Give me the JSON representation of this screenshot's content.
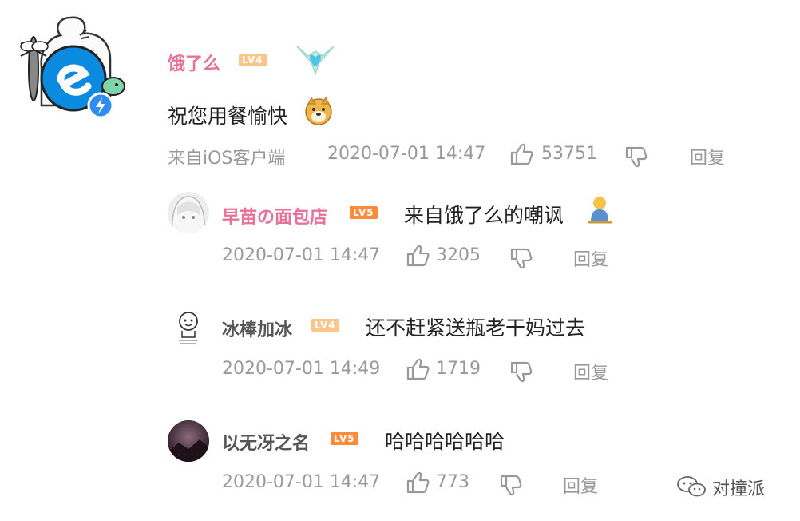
{
  "main_comment": {
    "username": "饿了么",
    "level": "LV4",
    "text": "祝您用餐愉快",
    "source": "来自iOS客户端",
    "time": "2020-07-01 14:47",
    "likes": "53751",
    "reply_label": "回复"
  },
  "replies": [
    {
      "username": "早苗の面包店",
      "level": "LV5",
      "text": "来自饿了么的嘲讽",
      "time": "2020-07-01 14:47",
      "likes": "3205",
      "reply_label": "回复"
    },
    {
      "username": "冰棒加冰",
      "level": "LV4",
      "text": "还不赶紧送瓶老干妈过去",
      "time": "2020-07-01 14:49",
      "likes": "1719",
      "reply_label": "回复"
    },
    {
      "username": "以无冴之名",
      "level": "LV5",
      "text": "哈哈哈哈哈哈",
      "time": "2020-07-01 14:47",
      "likes": "773",
      "reply_label": "回复"
    }
  ],
  "watermark": {
    "text": "对撞派"
  },
  "colors": {
    "pink_name": "#e8719a",
    "meta_gray": "#999999",
    "lv4": "#ffc488",
    "lv5": "#ff8a3a",
    "eleme_blue": "#0a8be0"
  }
}
